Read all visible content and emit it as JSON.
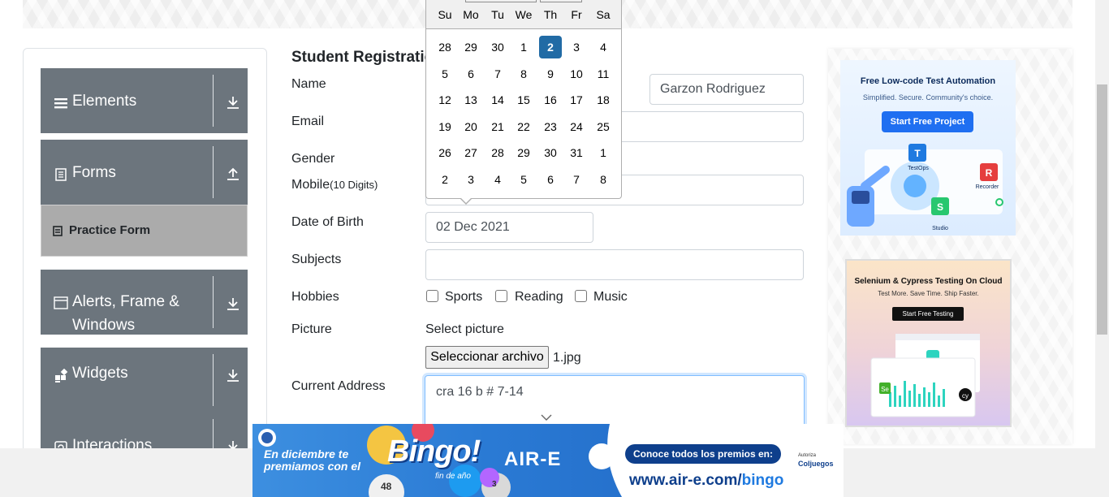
{
  "sidebar": {
    "groups": [
      {
        "label": "Elements",
        "icon": "menu-icon",
        "arrow": "download-arrow-icon"
      },
      {
        "label": "Forms",
        "icon": "document-icon",
        "arrow": "upload-arrow-icon"
      },
      {
        "label": "Alerts, Frame &",
        "label2": "Windows",
        "icon": "window-icon",
        "arrow": "download-arrow-icon"
      },
      {
        "label": "Widgets",
        "icon": "widgets-icon",
        "arrow": "download-arrow-icon"
      },
      {
        "label": "Interactions",
        "icon": "interactions-icon",
        "arrow": "download-arrow-icon"
      }
    ],
    "active_item": {
      "label": "Practice Form",
      "icon": "form-icon"
    }
  },
  "form": {
    "title": "Student Registratio",
    "labels": {
      "name": "Name",
      "email": "Email",
      "gender": "Gender",
      "mobile": "Mobile",
      "mobile_hint": "(10 Digits)",
      "dob": "Date of Birth",
      "subjects": "Subjects",
      "hobbies": "Hobbies",
      "picture": "Picture",
      "address": "Current Address"
    },
    "last_name_value": "Garzon Rodriguez",
    "dob_value": "02 Dec 2021",
    "hobbies": [
      "Sports",
      "Reading",
      "Music"
    ],
    "picture_prompt": "Select picture",
    "file_button": "Seleccionar archivo",
    "file_name": "1.jpg",
    "address_value": "cra 16 b # 7-14"
  },
  "datepicker": {
    "weekdays": [
      "Su",
      "Mo",
      "Tu",
      "We",
      "Th",
      "Fr",
      "Sa"
    ],
    "weeks": [
      [
        "28",
        "29",
        "30",
        "1",
        "2",
        "3",
        "4"
      ],
      [
        "5",
        "6",
        "7",
        "8",
        "9",
        "10",
        "11"
      ],
      [
        "12",
        "13",
        "14",
        "15",
        "16",
        "17",
        "18"
      ],
      [
        "19",
        "20",
        "21",
        "22",
        "23",
        "24",
        "25"
      ],
      [
        "26",
        "27",
        "28",
        "29",
        "30",
        "31",
        "1"
      ],
      [
        "2",
        "3",
        "4",
        "5",
        "6",
        "7",
        "8"
      ]
    ],
    "selected": "2"
  },
  "ads": {
    "ad1": {
      "title": "Free Low-code Test Automation",
      "subtitle": "Simplified. Secure. Community's choice.",
      "button": "Start Free Project",
      "nodes": [
        "TestOps",
        "Recorder",
        "Studio"
      ]
    },
    "ad2": {
      "title": "Selenium & Cypress Testing On Cloud",
      "subtitle": "Test More. Save Time. Ship Faster.",
      "button": "Start Free Testing"
    },
    "bingo": {
      "line1": "En diciembre te",
      "line2": "premiamos con el",
      "bingo": "Bingo!",
      "bingo_sub": "fin de año",
      "brand": "AIR-E",
      "cta": "Conoce todos los premios en:",
      "url_prefix": "www.air-e.com/",
      "url_suffix": "bingo",
      "auth_small": "Autoriza",
      "auth_brand": "Coljuegos",
      "balls": [
        "48",
        "3"
      ]
    }
  },
  "colors": {
    "sidebar_header": "#6c757d",
    "active_item": "#ababab",
    "selected_day": "#216ba5",
    "focus_border": "#80bdff"
  }
}
